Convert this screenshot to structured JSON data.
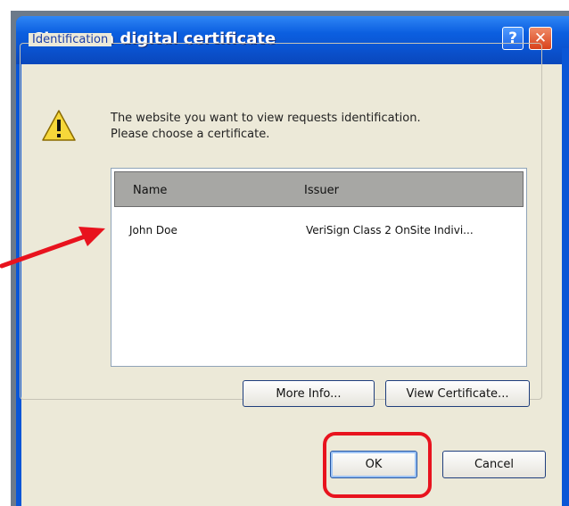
{
  "dialog": {
    "title": "Choose a digital certificate",
    "help_glyph": "?",
    "close_glyph": "✕"
  },
  "group": {
    "label": "Identification"
  },
  "message": {
    "line1": "The website you want to view requests identification.",
    "line2": "Please choose a certificate."
  },
  "certificates": {
    "columns": [
      "Name",
      "Issuer"
    ],
    "rows": [
      {
        "name": "John Doe",
        "issuer": "VeriSign Class 2 OnSite Indivi..."
      }
    ]
  },
  "buttons": {
    "more_info": "More Info...",
    "view_certificate": "View Certificate...",
    "ok": "OK",
    "cancel": "Cancel"
  },
  "annotations": {
    "highlight_color": "#e8131e"
  },
  "icons": {
    "warning": "warning-triangle-icon",
    "arrow": "annotation-arrow"
  }
}
